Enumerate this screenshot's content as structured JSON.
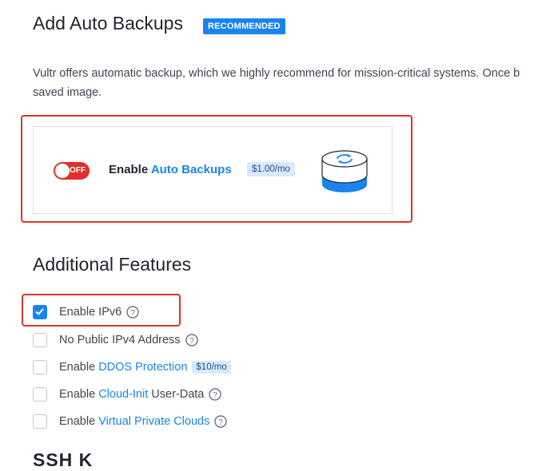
{
  "backups": {
    "title": "Add Auto Backups",
    "badge": "RECOMMENDED",
    "description_line1": "Vultr offers automatic backup, which we highly recommend for mission-critical systems. Once b",
    "description_line2": "saved image.",
    "toggle_state": "OFF",
    "enable_prefix": "Enable",
    "enable_link": "Auto Backups",
    "price": "$1.00/mo"
  },
  "features": {
    "title": "Additional Features",
    "options": [
      {
        "prefix": "Enable IPv6",
        "link": "",
        "suffix": "",
        "checked": true,
        "price": ""
      },
      {
        "prefix": "No Public IPv4 Address",
        "link": "",
        "suffix": "",
        "checked": false,
        "price": ""
      },
      {
        "prefix": "Enable",
        "link": "DDOS Protection",
        "suffix": "",
        "checked": false,
        "price": "$10/mo"
      },
      {
        "prefix": "Enable",
        "link": "Cloud-Init",
        "suffix": "User-Data",
        "checked": false,
        "price": ""
      },
      {
        "prefix": "Enable",
        "link": "Virtual Private Clouds",
        "suffix": "",
        "checked": false,
        "price": ""
      }
    ]
  },
  "next_section_partial": "SSH K",
  "colors": {
    "accent": "#1a84ee",
    "danger": "#e0302b",
    "price_bg": "#d9e9fb"
  }
}
